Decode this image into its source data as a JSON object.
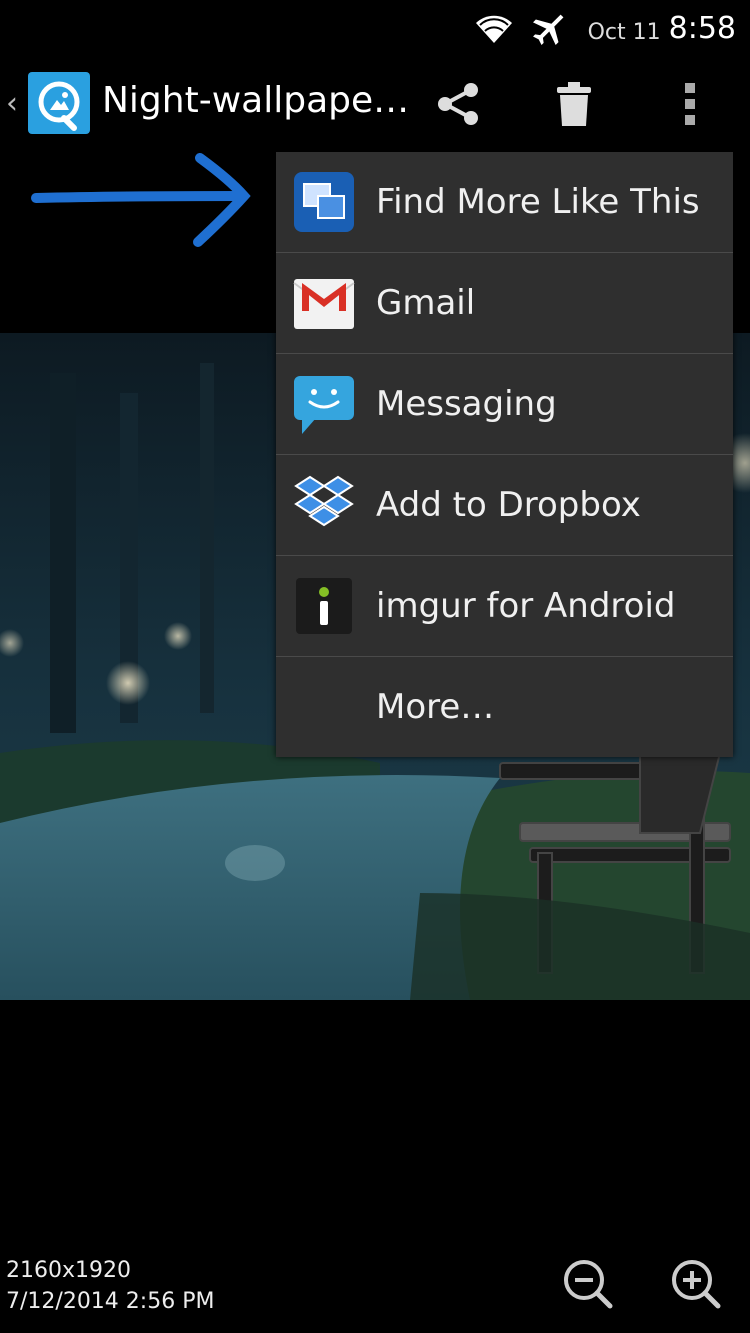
{
  "status_bar": {
    "date": "Oct 11",
    "time": "8:58",
    "icons": [
      "wifi-icon",
      "airplane-icon"
    ]
  },
  "action_bar": {
    "title": "Night-wallpape…",
    "icons": [
      "back-caret",
      "app-icon",
      "share-icon",
      "trash-icon",
      "overflow-menu-icon"
    ]
  },
  "share_menu": {
    "items": [
      {
        "label": "Find More Like This",
        "icon": "find-similar-icon"
      },
      {
        "label": "Gmail",
        "icon": "gmail-icon"
      },
      {
        "label": "Messaging",
        "icon": "messaging-icon"
      },
      {
        "label": "Add to Dropbox",
        "icon": "dropbox-icon"
      },
      {
        "label": "imgur for Android",
        "icon": "imgur-icon"
      },
      {
        "label": "More…",
        "icon": ""
      }
    ]
  },
  "image_info": {
    "resolution": "2160x1920",
    "date": "7/12/2014 2:56 PM"
  },
  "footer": {
    "icons": [
      "zoom-out-icon",
      "zoom-in-icon"
    ]
  },
  "colors": {
    "accent": "#2aa0e0",
    "menu_bg": "#2f2f2f",
    "arrow": "#1f6fd1"
  }
}
